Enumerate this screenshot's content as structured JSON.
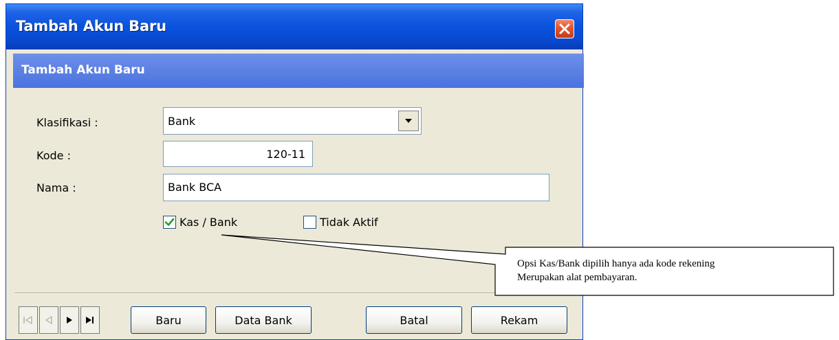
{
  "window": {
    "title": "Tambah Akun Baru",
    "header": "Tambah Akun Baru"
  },
  "form": {
    "klasifikasi_label": "Klasifikasi :",
    "klasifikasi_value": "Bank",
    "kode_label": "Kode :",
    "kode_value": "120-11",
    "nama_label": "Nama :",
    "nama_value": "Bank BCA",
    "kas_bank_label": "Kas / Bank",
    "kas_bank_checked": true,
    "tidak_aktif_label": "Tidak Aktif",
    "tidak_aktif_checked": false
  },
  "footer": {
    "nav": [
      "first-icon",
      "prev-icon",
      "next-icon",
      "last-icon"
    ],
    "baru_label": "Baru",
    "data_bank_label": "Data Bank",
    "batal_label": "Batal",
    "rekam_label": "Rekam"
  },
  "callout": {
    "line1": "Opsi Kas/Bank dipilih hanya ada kode rekening",
    "line2": "Merupakan alat pembayaran."
  },
  "colors": {
    "titlebar": "#0a52dd",
    "header_band": "#5a7fe3",
    "close_button": "#e15b33",
    "window_bg": "#ece9d8"
  }
}
